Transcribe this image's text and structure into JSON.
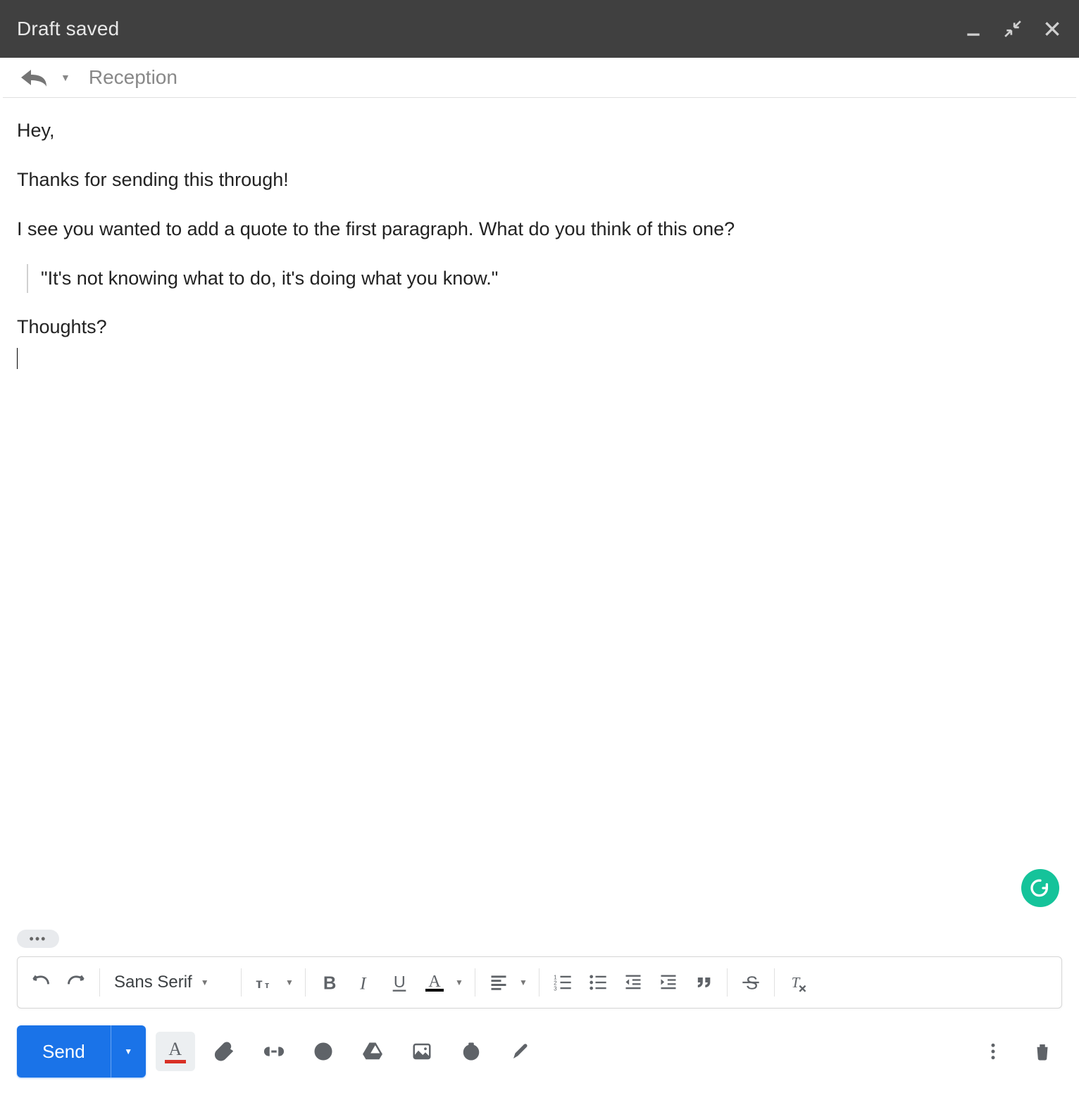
{
  "titlebar": {
    "title": "Draft saved"
  },
  "recipients": {
    "label": "Reception"
  },
  "body": {
    "greeting": "Hey,",
    "line1": "Thanks for sending this through!",
    "line2": "I see you wanted to add a quote to the first paragraph. What do you think of this one?",
    "quote": "\"It's not knowing what to do, it's doing what you know.\"",
    "closing": "Thoughts?"
  },
  "toolbar": {
    "font": "Sans Serif",
    "send_label": "Send"
  }
}
